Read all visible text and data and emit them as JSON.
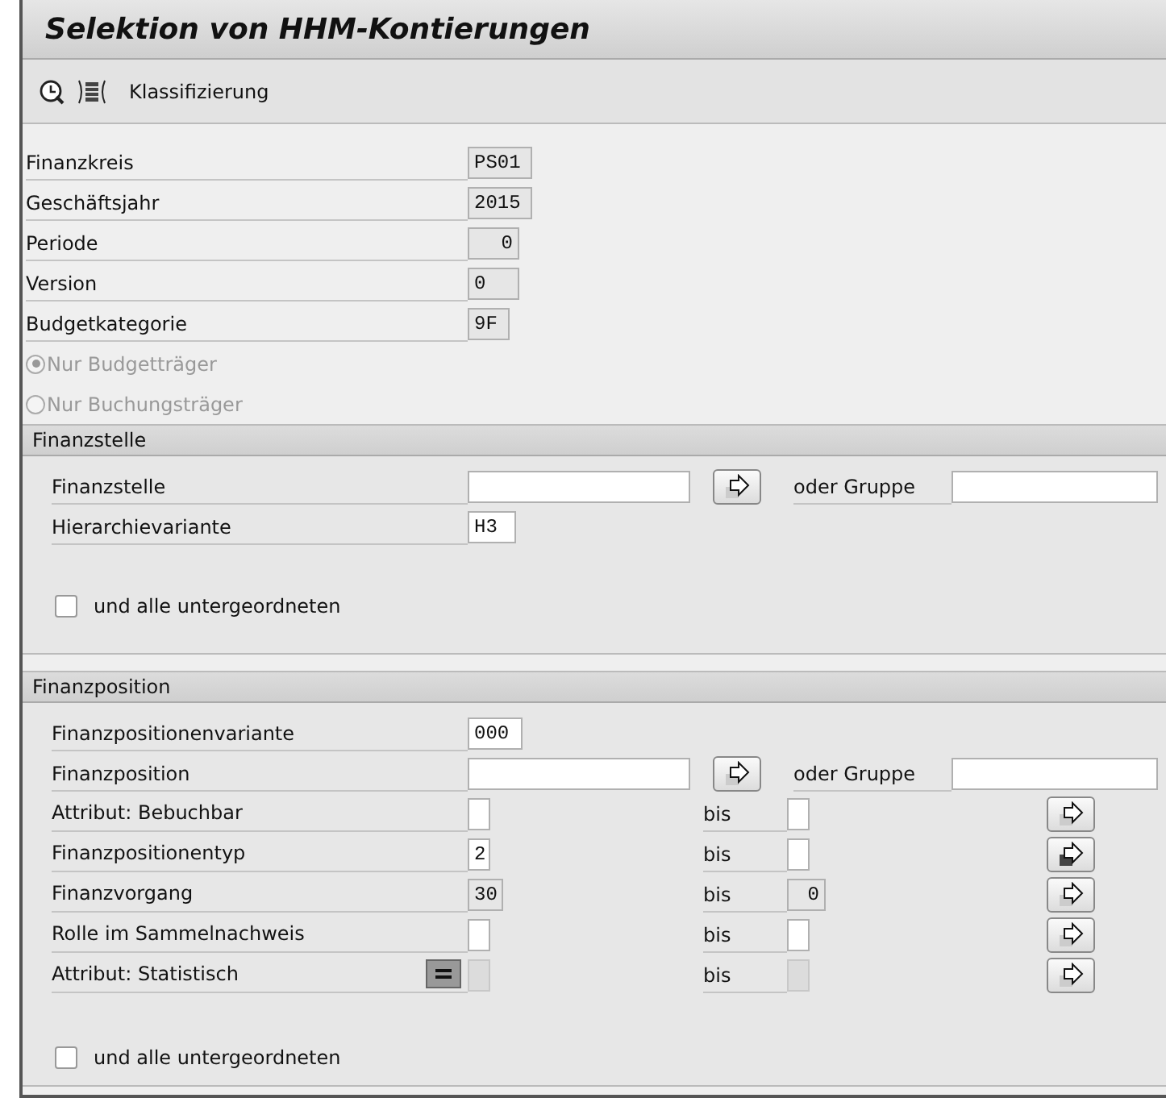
{
  "window": {
    "title": "Selektion von HHM-Kontierungen"
  },
  "toolbar": {
    "items": [
      {
        "kind": "clock"
      },
      {
        "kind": "bracket"
      },
      {
        "kind": "text",
        "label": "Klassifizierung"
      }
    ]
  },
  "header_fields": [
    {
      "label": "Finanzkreis",
      "value": "PS01",
      "editable": false,
      "numeric": false
    },
    {
      "label": "Geschäftsjahr",
      "value": "2015",
      "editable": false,
      "numeric": false
    },
    {
      "label": "Periode",
      "value": "0",
      "editable": false,
      "numeric": true
    },
    {
      "label": "Version",
      "value": "0",
      "editable": false,
      "numeric": false
    },
    {
      "label": "Budgetkategorie",
      "value": "9F",
      "editable": false,
      "numeric": false
    }
  ],
  "radios": [
    {
      "label": "Nur Budgetträger",
      "selected": true,
      "disabled": true
    },
    {
      "label": "Nur Buchungsträger",
      "selected": false,
      "disabled": true
    }
  ],
  "groups": [
    {
      "title": "Finanzstelle",
      "rows": [
        {
          "kind": "group",
          "label": "Finanzstelle",
          "value": "",
          "or_label": "oder Gruppe",
          "group_value": ""
        },
        {
          "kind": "single",
          "label": "Hierarchievariante",
          "value": "H3"
        }
      ],
      "checkbox": {
        "label": "und alle untergeordneten",
        "checked": false
      }
    },
    {
      "title": "Finanzposition",
      "rows": [
        {
          "kind": "single",
          "label": "Finanzpositionenvariante",
          "value": "000"
        },
        {
          "kind": "group",
          "label": "Finanzposition",
          "value": "",
          "or_label": "oder Gruppe",
          "group_value": ""
        },
        {
          "kind": "range",
          "label": "Attribut: Bebuchbar",
          "from": "",
          "to_label": "bis",
          "to": "",
          "editable": true,
          "has_entries": false,
          "help_button": false
        },
        {
          "kind": "range",
          "label": "Finanzpositionentyp",
          "from": "2",
          "to_label": "bis",
          "to": "",
          "editable": true,
          "has_entries": true,
          "help_button": false
        },
        {
          "kind": "range",
          "label": "Finanzvorgang",
          "from": "30",
          "to_label": "bis",
          "to": "0",
          "editable": false,
          "has_entries": false,
          "help_button": false
        },
        {
          "kind": "range",
          "label": "Rolle im Sammelnachweis",
          "from": "",
          "to_label": "bis",
          "to": "",
          "editable": true,
          "has_entries": false,
          "help_button": false
        },
        {
          "kind": "range",
          "label": "Attribut: Statistisch",
          "from": "",
          "to_label": "bis",
          "to": "",
          "editable": false,
          "has_entries": false,
          "help_button": true
        }
      ],
      "checkbox": {
        "label": "und alle untergeordneten",
        "checked": false
      }
    }
  ]
}
